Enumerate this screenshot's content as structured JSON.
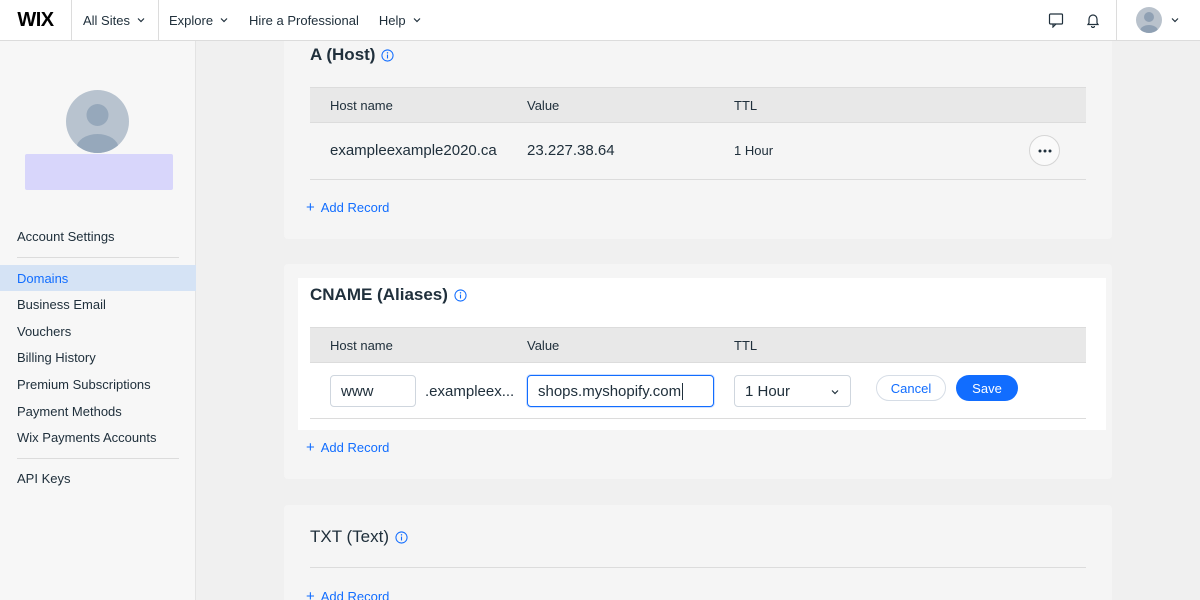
{
  "topbar": {
    "logo": "WIX",
    "all_sites": "All Sites",
    "explore": "Explore",
    "hire": "Hire a Professional",
    "help": "Help"
  },
  "sidebar": {
    "items": [
      {
        "label": "Account Settings"
      },
      {
        "label": "Domains"
      },
      {
        "label": "Business Email"
      },
      {
        "label": "Vouchers"
      },
      {
        "label": "Billing History"
      },
      {
        "label": "Premium Subscriptions"
      },
      {
        "label": "Payment Methods"
      },
      {
        "label": "Wix Payments Accounts"
      },
      {
        "label": "API Keys"
      }
    ]
  },
  "a_record": {
    "title": "A (Host)",
    "headers": {
      "host": "Host name",
      "value": "Value",
      "ttl": "TTL"
    },
    "row": {
      "host": "exampleexample2020.ca",
      "value": "23.227.38.64",
      "ttl": "1 Hour"
    },
    "add_record": "Add Record"
  },
  "cname": {
    "title": "CNAME (Aliases)",
    "headers": {
      "host": "Host name",
      "value": "Value",
      "ttl": "TTL"
    },
    "host_input": "www",
    "domain_suffix": ".exampleex...",
    "value_input": "shops.myshopify.com",
    "ttl_select": "1 Hour",
    "cancel": "Cancel",
    "save": "Save",
    "add_record": "Add Record"
  },
  "txt": {
    "title": "TXT (Text)",
    "add_record": "Add Record"
  },
  "colors": {
    "accent": "#116dff",
    "active_bg": "#d5e3f5"
  }
}
